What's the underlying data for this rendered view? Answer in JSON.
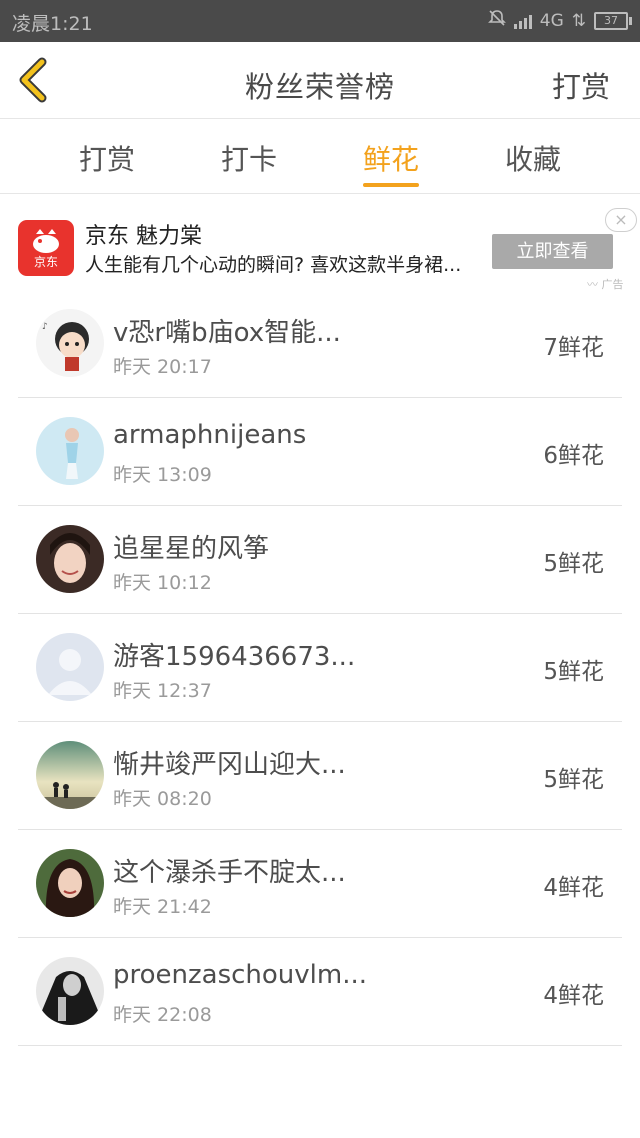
{
  "status_bar": {
    "time": "凌晨1:21",
    "network": "4G",
    "battery": "37"
  },
  "header": {
    "title": "粉丝荣誉榜",
    "right_action": "打赏"
  },
  "tabs": [
    {
      "label": "打赏",
      "active": false
    },
    {
      "label": "打卡",
      "active": false
    },
    {
      "label": "鲜花",
      "active": true
    },
    {
      "label": "收藏",
      "active": false
    }
  ],
  "ad": {
    "logo_text": "京东",
    "title": "京东 魅力棠",
    "description": "人生能有几个心动的瞬间? 喜欢这款半身裙...",
    "button": "立即查看",
    "close": "×",
    "tag": "广告"
  },
  "fans": [
    {
      "name": "v恐r嘴b庙ox智能...",
      "time": "昨天 20:17",
      "count": "7鲜花",
      "avatar": "cartoon-girl-avatar"
    },
    {
      "name": "armaphnijeans",
      "time": "昨天 13:09",
      "count": "6鲜花",
      "avatar": "light-blue-avatar"
    },
    {
      "name": "追星星的风筝",
      "time": "昨天 10:12",
      "count": "5鲜花",
      "avatar": "smiling-girl-avatar"
    },
    {
      "name": "游客1596436673...",
      "time": "昨天 12:37",
      "count": "5鲜花",
      "avatar": "default-user-avatar"
    },
    {
      "name": "惭井竣严冈山迎大...",
      "time": "昨天 08:20",
      "count": "5鲜花",
      "avatar": "sunset-couple-avatar"
    },
    {
      "name": "这个瀑杀手不腚太...",
      "time": "昨天 21:42",
      "count": "4鲜花",
      "avatar": "dark-hair-girl-avatar"
    },
    {
      "name": "proenzaschouvlm...",
      "time": "昨天 22:08",
      "count": "4鲜花",
      "avatar": "black-white-avatar"
    }
  ],
  "colors": {
    "accent": "#f3a21d",
    "status_bar": "#4a4a4a",
    "ad_red": "#e8332d"
  }
}
